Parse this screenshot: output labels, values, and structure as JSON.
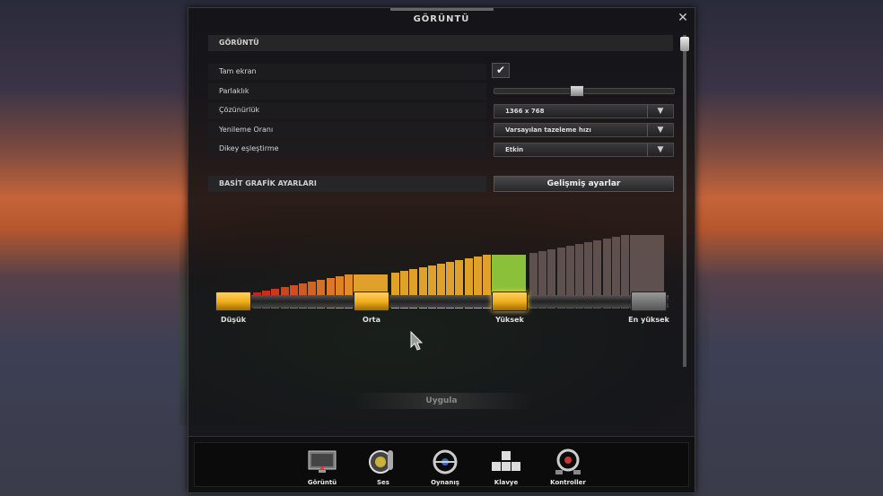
{
  "window": {
    "title": "GÖRÜNTÜ",
    "close_icon": "close-icon"
  },
  "section_display": "GÖRÜNTÜ",
  "rows": {
    "fullscreen": {
      "label": "Tam ekran",
      "checked": true
    },
    "brightness": {
      "label": "Parlaklık",
      "value": 0.45
    },
    "resolution": {
      "label": "Çözünürlük",
      "value": "1366 x 768"
    },
    "refresh": {
      "label": "Yenileme Oranı",
      "value": "Varsayılan tazeleme hızı"
    },
    "vsync": {
      "label": "Dikey eşleştirme",
      "value": "Etkin"
    }
  },
  "section_basic": "BASİT GRAFİK AYARLARI",
  "advanced_button": "Gelişmiş ayarlar",
  "quality_levels": [
    {
      "label": "Düşük"
    },
    {
      "label": "Orta"
    },
    {
      "label": "Yüksek"
    },
    {
      "label": "En yüksek"
    }
  ],
  "selected_level": "Yüksek",
  "apply_button": "Uygula",
  "tabs": [
    {
      "label": "Görüntü",
      "icon": "monitor-icon"
    },
    {
      "label": "Ses",
      "icon": "speaker-icon"
    },
    {
      "label": "Oynanış",
      "icon": "steering-wheel-icon"
    },
    {
      "label": "Klavye",
      "icon": "keyboard-icon"
    },
    {
      "label": "Kontroller",
      "icon": "controller-wheel-icon"
    }
  ],
  "colors": {
    "low": "#c8241a",
    "mid": "#e0a12a",
    "high": "#8bc03a",
    "ultra": "#6a5a58",
    "knob_active": "#f0b020"
  }
}
